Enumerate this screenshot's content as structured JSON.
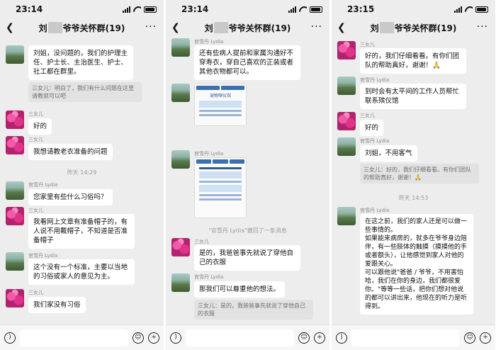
{
  "app": {
    "group_title_left": "刘",
    "group_title_right": "爷爷关怀群(19)",
    "back_icon": "chevron-left-icon",
    "more_icon": "more-icon"
  },
  "input_bar": {
    "voice_icon": "voice-icon",
    "emoji_icon": "emoji-icon",
    "plus_icon": "plus-icon"
  },
  "screens": [
    {
      "time": "23:14",
      "messages": [
        {
          "text": "刘姐，没问题的，我们的护理主任、护士长、主治医生、护士、社工都在群里。",
          "quote": "三女儿：明白了，我们有什么问题在这里请教就可以吧"
        },
        {
          "sender": "三女儿",
          "text": "好的"
        },
        {
          "sender": "三女儿",
          "text": "我想请教老衣准备的问题"
        },
        {
          "timestamp": "昨天 14:29"
        },
        {
          "sender": "官雪丹 Lydia",
          "text": "您家里有些什么习俗吗？"
        },
        {
          "sender": "三女儿",
          "text": "我看网上文章有准备帽子的，有人说不用戴帽子，不知道是否准备帽子"
        },
        {
          "sender": "官雪丹 Lydia",
          "text": "这个没有一个标准，主要以当地的习俗或家人的意见为主。"
        },
        {
          "sender": "三女儿",
          "text": "我们家没有习俗"
        }
      ]
    },
    {
      "time": "23:14",
      "messages": [
        {
          "sender": "官雪丹 Lydia",
          "text": "还有些病人提前和家属沟通好不穿寿衣，穿自己喜欢的正装或者其他衣物都可以。"
        },
        {
          "sender": "官雪丹 Lydia",
          "image_header": "宠物殡仪馆"
        },
        {
          "sender": "官雪丹 Lydia"
        },
        {
          "system": "\"官雪丹 Lydia\"撤回了一条消息"
        },
        {
          "sender": "三女儿",
          "text": "是的，我爸爸事先就说了穿他自己的衣服"
        },
        {
          "sender": "官雪丹 Lydia",
          "text": "那我们可以尊重他的想法。"
        },
        {
          "quote": "三女儿：是的，我爸爸事先就说了穿他自己的衣服"
        }
      ]
    },
    {
      "time": "23:15",
      "messages": [
        {
          "sender": "三女儿",
          "text": "好的，我们仔细看看。有你们团队的帮助真好，谢谢！🙏"
        },
        {
          "sender": "官雪丹 Lydia",
          "text": "到时会有太平间的工作人员帮忙联系殡仪馆"
        },
        {
          "sender": "三女儿",
          "text": "好的"
        },
        {
          "sender": "官雪丹 Lydia",
          "text": "刘姐，不用客气",
          "quote": "三女儿：好的，我们仔细看看。有你们团队的帮助真好，谢谢！🙏"
        },
        {
          "timestamp": "昨天 14:53"
        },
        {
          "sender": "官雪丹 Lydia",
          "text": "在这之前，我们的家人还是可以做一些事情的。\n如果能来病房的，就多在爷爷身边陪伴，有一些肢体的触摸（摸摸他的手或者额头），让他感觉到家人对他的爱跟关心。\n可以跟他说\"爸爸 / 爷爷，不用害怕哈，我们在你的身边，我们都很爱你。\"等等一些话，把你们想对他说的都可以讲出来，他现在的听力是听得到。"
        }
      ]
    }
  ]
}
